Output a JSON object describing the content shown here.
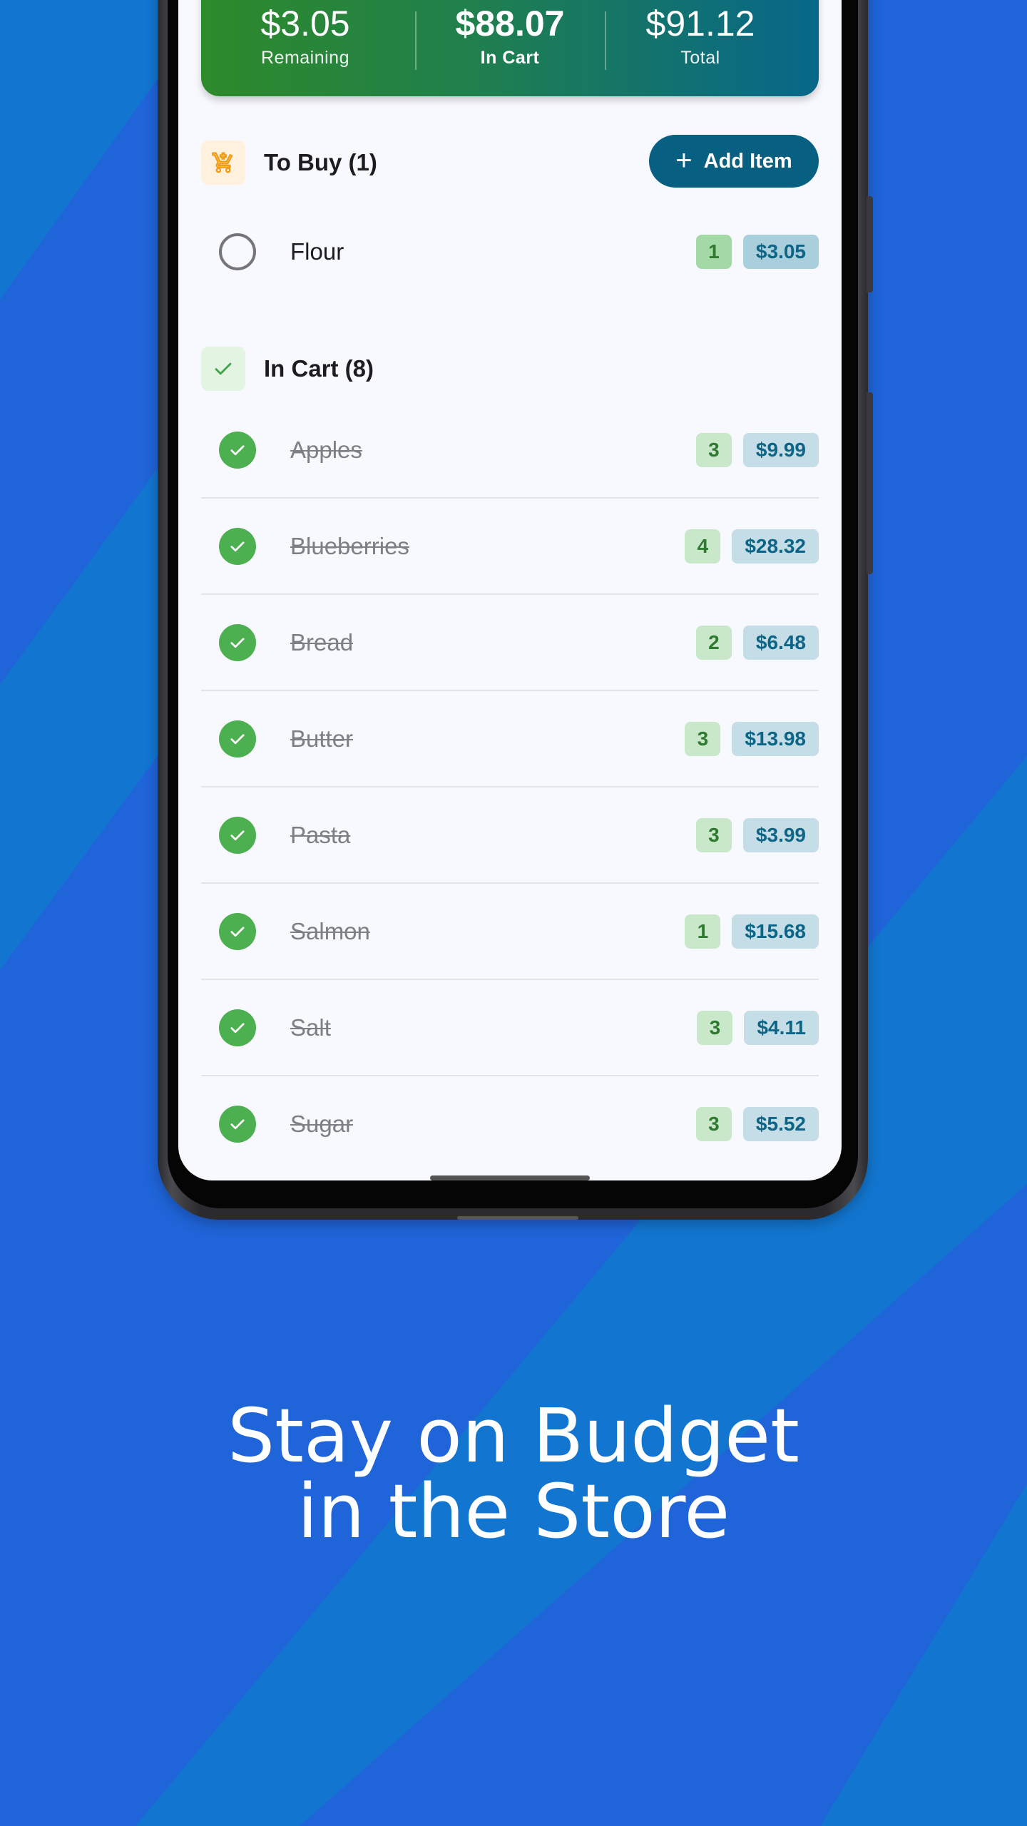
{
  "colors": {
    "background": "#1f64d8",
    "background_stripe": "#1276d0",
    "summary_start": "#2e8a2a",
    "summary_end": "#07678a",
    "primary_button": "#075f82",
    "check_green": "#4caf50"
  },
  "summary": {
    "remaining_amount": "$3.05",
    "remaining_label": "Remaining",
    "in_cart_amount": "$88.07",
    "in_cart_label": "In Cart",
    "total_amount": "$91.12",
    "total_label": "Total"
  },
  "to_buy": {
    "icon": "shopping-cart-icon",
    "title": "To Buy (1)",
    "add_button_label": "Add Item",
    "items": [
      {
        "name": "Flour",
        "qty": "1",
        "price": "$3.05"
      }
    ]
  },
  "in_cart": {
    "icon": "checkmark-icon",
    "title": "In Cart (8)",
    "items": [
      {
        "name": "Apples",
        "qty": "3",
        "price": "$9.99"
      },
      {
        "name": "Blueberries",
        "qty": "4",
        "price": "$28.32"
      },
      {
        "name": "Bread",
        "qty": "2",
        "price": "$6.48"
      },
      {
        "name": "Butter",
        "qty": "3",
        "price": "$13.98"
      },
      {
        "name": "Pasta",
        "qty": "3",
        "price": "$3.99"
      },
      {
        "name": "Salmon",
        "qty": "1",
        "price": "$15.68"
      },
      {
        "name": "Salt",
        "qty": "3",
        "price": "$4.11"
      },
      {
        "name": "Sugar",
        "qty": "3",
        "price": "$5.52"
      }
    ]
  },
  "tagline": {
    "line1": "Stay on Budget",
    "line2": "in the Store"
  }
}
